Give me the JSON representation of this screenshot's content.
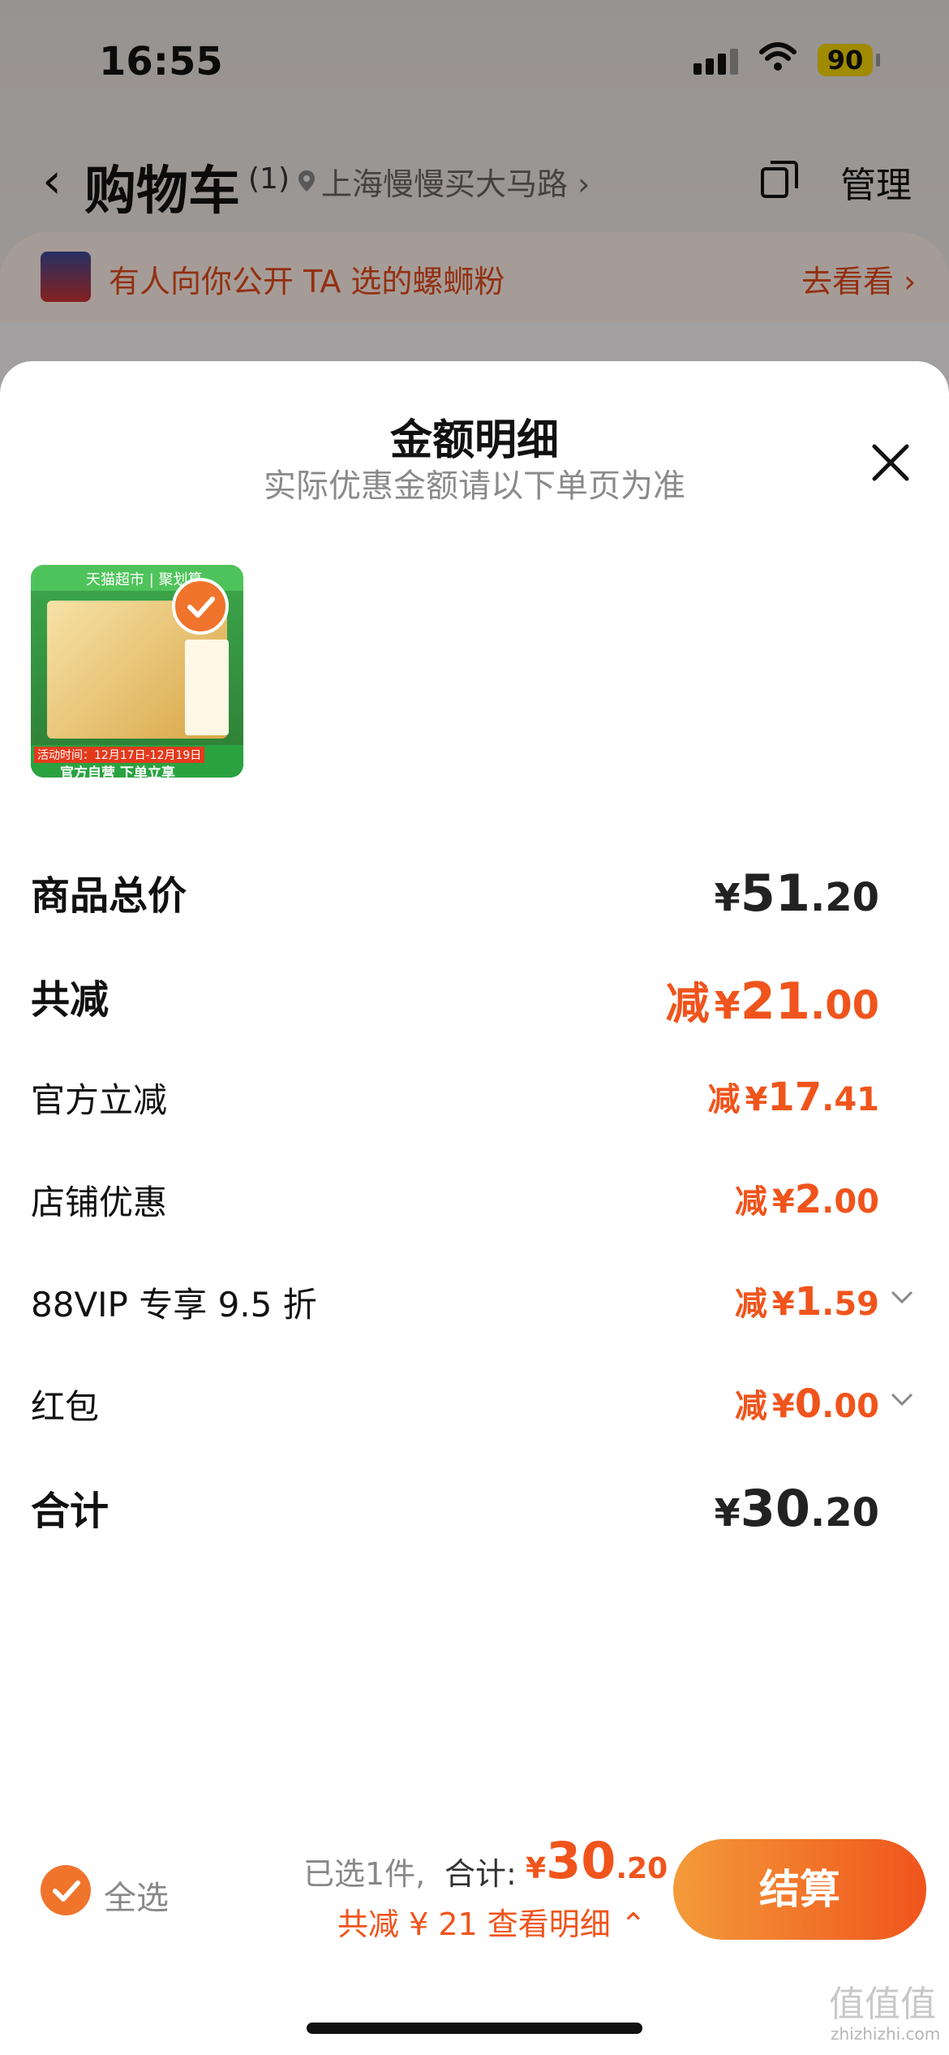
{
  "status_bar": {
    "time": "16:55",
    "battery": "90"
  },
  "nav": {
    "title": "购物车",
    "count": "(1)",
    "location": "上海慢慢买大马路 ›",
    "manage": "管理"
  },
  "banner": {
    "text": "有人向你公开 TA 选的螺蛳粉",
    "link": "去看看 ›"
  },
  "sheet": {
    "title": "金额明细",
    "subtitle": "实际优惠金额请以下单页为准",
    "product": {
      "badge": "天猫超市 | 聚划算",
      "promo_time": "活动时间：12月17日-12月19日",
      "footer": "官方自营 下单立享"
    },
    "rows": [
      {
        "label": "商品总价",
        "prefix": "",
        "currency": "¥",
        "int": "51",
        "dec": ".20"
      },
      {
        "label": "共减",
        "prefix": "减",
        "currency": "¥",
        "int": "21",
        "dec": ".00"
      },
      {
        "label": "官方立减",
        "prefix": "减",
        "currency": "¥",
        "int": "17",
        "dec": ".41"
      },
      {
        "label": "店铺优惠",
        "prefix": "减",
        "currency": "¥",
        "int": "2",
        "dec": ".00"
      },
      {
        "label": "88VIP 专享 9.5 折",
        "prefix": "减",
        "currency": "¥",
        "int": "1",
        "dec": ".59"
      },
      {
        "label": "红包",
        "prefix": "减",
        "currency": "¥",
        "int": "0",
        "dec": ".00"
      },
      {
        "label": "合计",
        "prefix": "",
        "currency": "¥",
        "int": "30",
        "dec": ".20"
      }
    ]
  },
  "bottom_bar": {
    "select_all": "全选",
    "selected": "已选1件,",
    "total_label": "合计:",
    "total_currency": "¥",
    "total_int": "30",
    "total_dec": ".20",
    "discount_link": "共减 ¥ 21 查看明细 ⌃",
    "checkout": "结算"
  },
  "watermark": {
    "text": "值值值",
    "url": "zhizhizhi.com"
  },
  "colors": {
    "accent": "#f0541c",
    "accent_gradient_start": "#f39b3a",
    "check": "#f0742c"
  }
}
